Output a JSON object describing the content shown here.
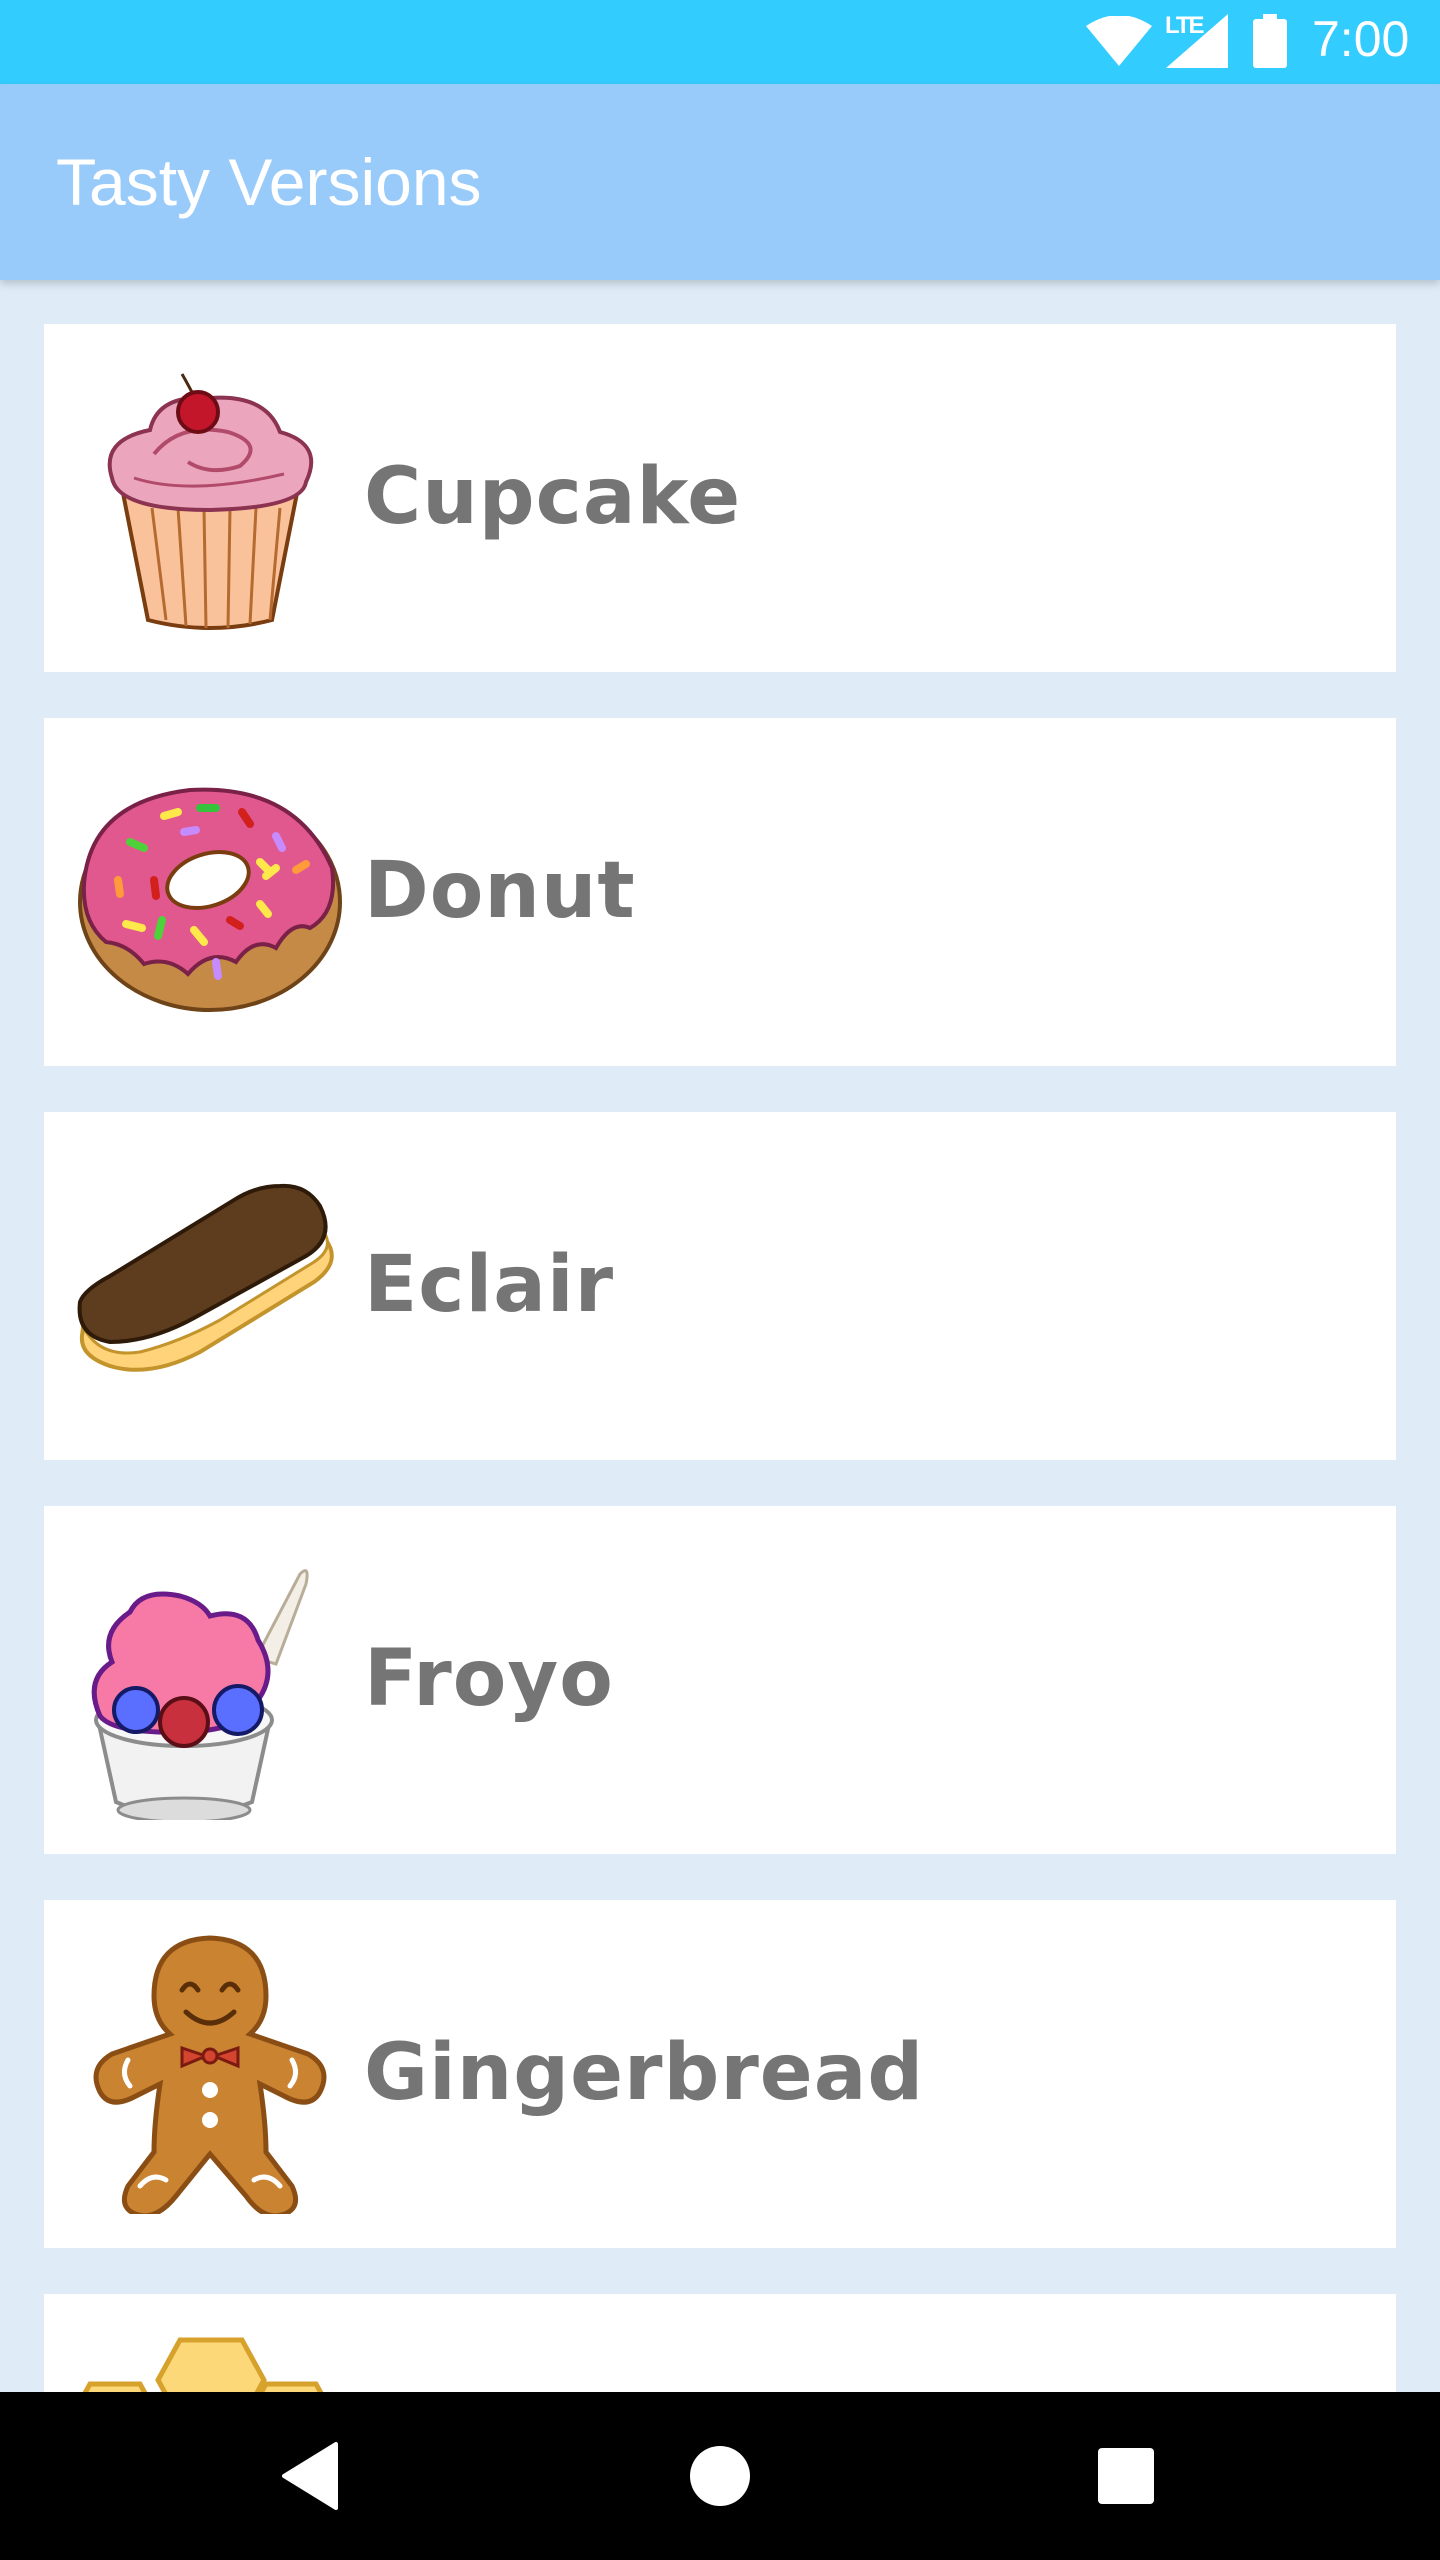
{
  "status_bar": {
    "time": "7:00",
    "network": "LTE",
    "icons": [
      "wifi-icon",
      "cell-signal-icon",
      "battery-icon"
    ],
    "color": "#33ccff"
  },
  "app_bar": {
    "title": "Tasty Versions",
    "color": "#99cbfa"
  },
  "list": {
    "items": [
      {
        "label": "Cupcake",
        "icon": "cupcake-icon"
      },
      {
        "label": "Donut",
        "icon": "donut-icon"
      },
      {
        "label": "Eclair",
        "icon": "eclair-icon"
      },
      {
        "label": "Froyo",
        "icon": "froyo-icon"
      },
      {
        "label": "Gingerbread",
        "icon": "gingerbread-icon"
      },
      {
        "label": "",
        "icon": "honeycomb-icon"
      }
    ]
  },
  "nav_bar": {
    "buttons": [
      "back-icon",
      "home-icon",
      "recents-icon"
    ]
  }
}
